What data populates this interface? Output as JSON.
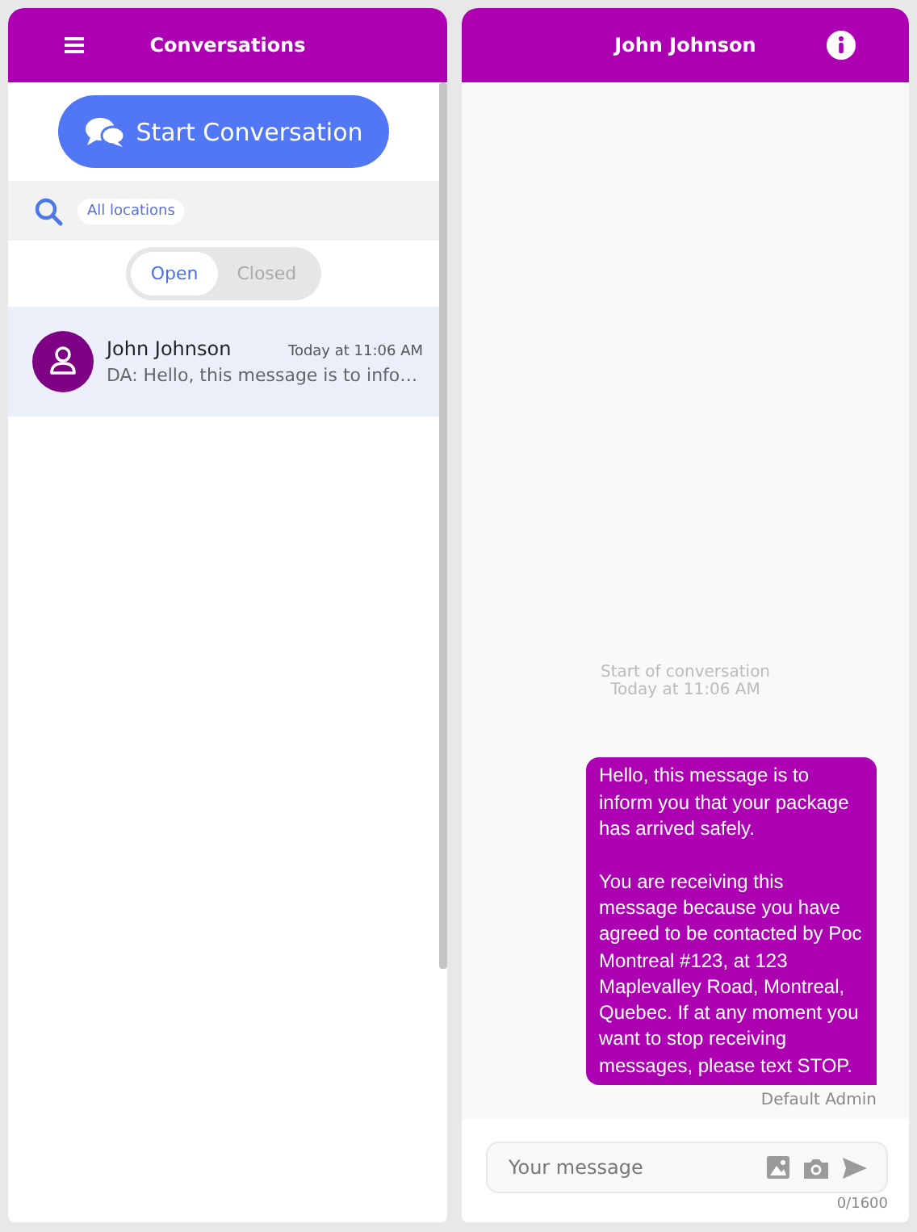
{
  "left_panel": {
    "title": "Conversations",
    "start_button": "Start Conversation",
    "location_filter": "All locations",
    "status_tabs": [
      {
        "label": "Open",
        "selected": true
      },
      {
        "label": "Closed",
        "selected": false
      }
    ],
    "conversations": [
      {
        "name": "John Johnson",
        "time": "Today at 11:06 AM",
        "preview": "DA: Hello, this message is to info…",
        "selected": true
      }
    ]
  },
  "right_panel": {
    "title": "John Johnson",
    "conversation_start": "Start of conversation",
    "start_time": "Today at 11:06 AM",
    "messages": [
      {
        "text": "Hello, this message is to inform you that your package has arrived safely.\n\nYou are receiving this message because you have agreed to be contacted by Poc Montreal #123, at 123 Maplevalley Road, Montreal, Quebec. If at any moment you want to stop receiving messages, please text STOP.",
        "sender": "Default Admin"
      }
    ],
    "composer": {
      "placeholder": "Your message",
      "counter": "0/1600"
    }
  }
}
